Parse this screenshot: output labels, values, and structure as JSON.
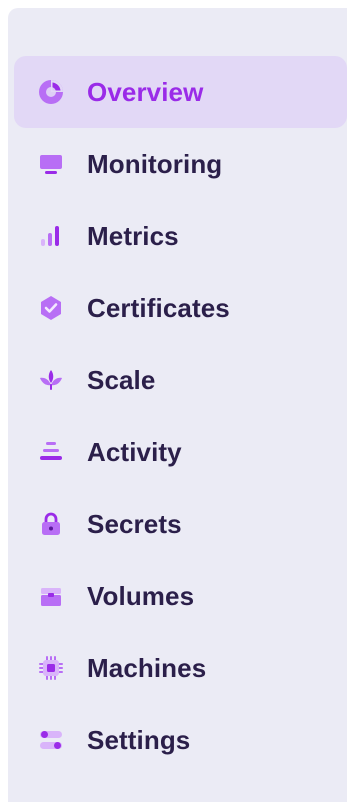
{
  "sidebar": {
    "accent_color": "#9a2be8",
    "active_bg": "#e2d8f6",
    "icon_color": "#b86ef5",
    "items": [
      {
        "label": "Overview",
        "icon": "pie-chart-icon",
        "active": true
      },
      {
        "label": "Monitoring",
        "icon": "monitor-icon",
        "active": false
      },
      {
        "label": "Metrics",
        "icon": "bar-chart-icon",
        "active": false
      },
      {
        "label": "Certificates",
        "icon": "badge-check-icon",
        "active": false
      },
      {
        "label": "Scale",
        "icon": "sprout-icon",
        "active": false
      },
      {
        "label": "Activity",
        "icon": "stack-icon",
        "active": false
      },
      {
        "label": "Secrets",
        "icon": "lock-icon",
        "active": false
      },
      {
        "label": "Volumes",
        "icon": "box-icon",
        "active": false
      },
      {
        "label": "Machines",
        "icon": "cpu-icon",
        "active": false
      },
      {
        "label": "Settings",
        "icon": "toggles-icon",
        "active": false
      }
    ]
  }
}
